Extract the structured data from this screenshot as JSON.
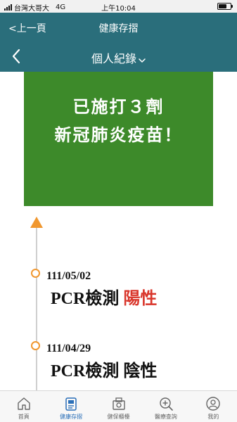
{
  "status_bar": {
    "carrier": "台灣大哥大",
    "network": "4G",
    "time": "上午10:04",
    "battery_level": 0.7
  },
  "nav": {
    "back_label": "<上一頁",
    "title": "健康存摺"
  },
  "sub_header": {
    "title": "個人紀錄"
  },
  "banner": {
    "line1": "已施打３劑",
    "line2": "新冠肺炎疫苗！",
    "color": "#3d8a2a"
  },
  "timeline": {
    "accent": "#f0972f",
    "entries": [
      {
        "date": "111/05/02",
        "test": "PCR檢測",
        "result": "陽性",
        "result_color": "#d9362b"
      },
      {
        "date": "111/04/29",
        "test": "PCR檢測",
        "result": "陰性",
        "result_color": "#111111"
      }
    ]
  },
  "tab_bar": {
    "active_color": "#2a6fb8",
    "tabs": [
      {
        "label": "首頁",
        "icon": "home-icon"
      },
      {
        "label": "健康存摺",
        "icon": "health-passbook-icon",
        "active": true
      },
      {
        "label": "健保櫃檯",
        "icon": "counter-icon"
      },
      {
        "label": "醫療查詢",
        "icon": "medical-search-icon"
      },
      {
        "label": "我的",
        "icon": "profile-icon"
      }
    ]
  },
  "theme": {
    "header_color": "#2a6e7b"
  }
}
